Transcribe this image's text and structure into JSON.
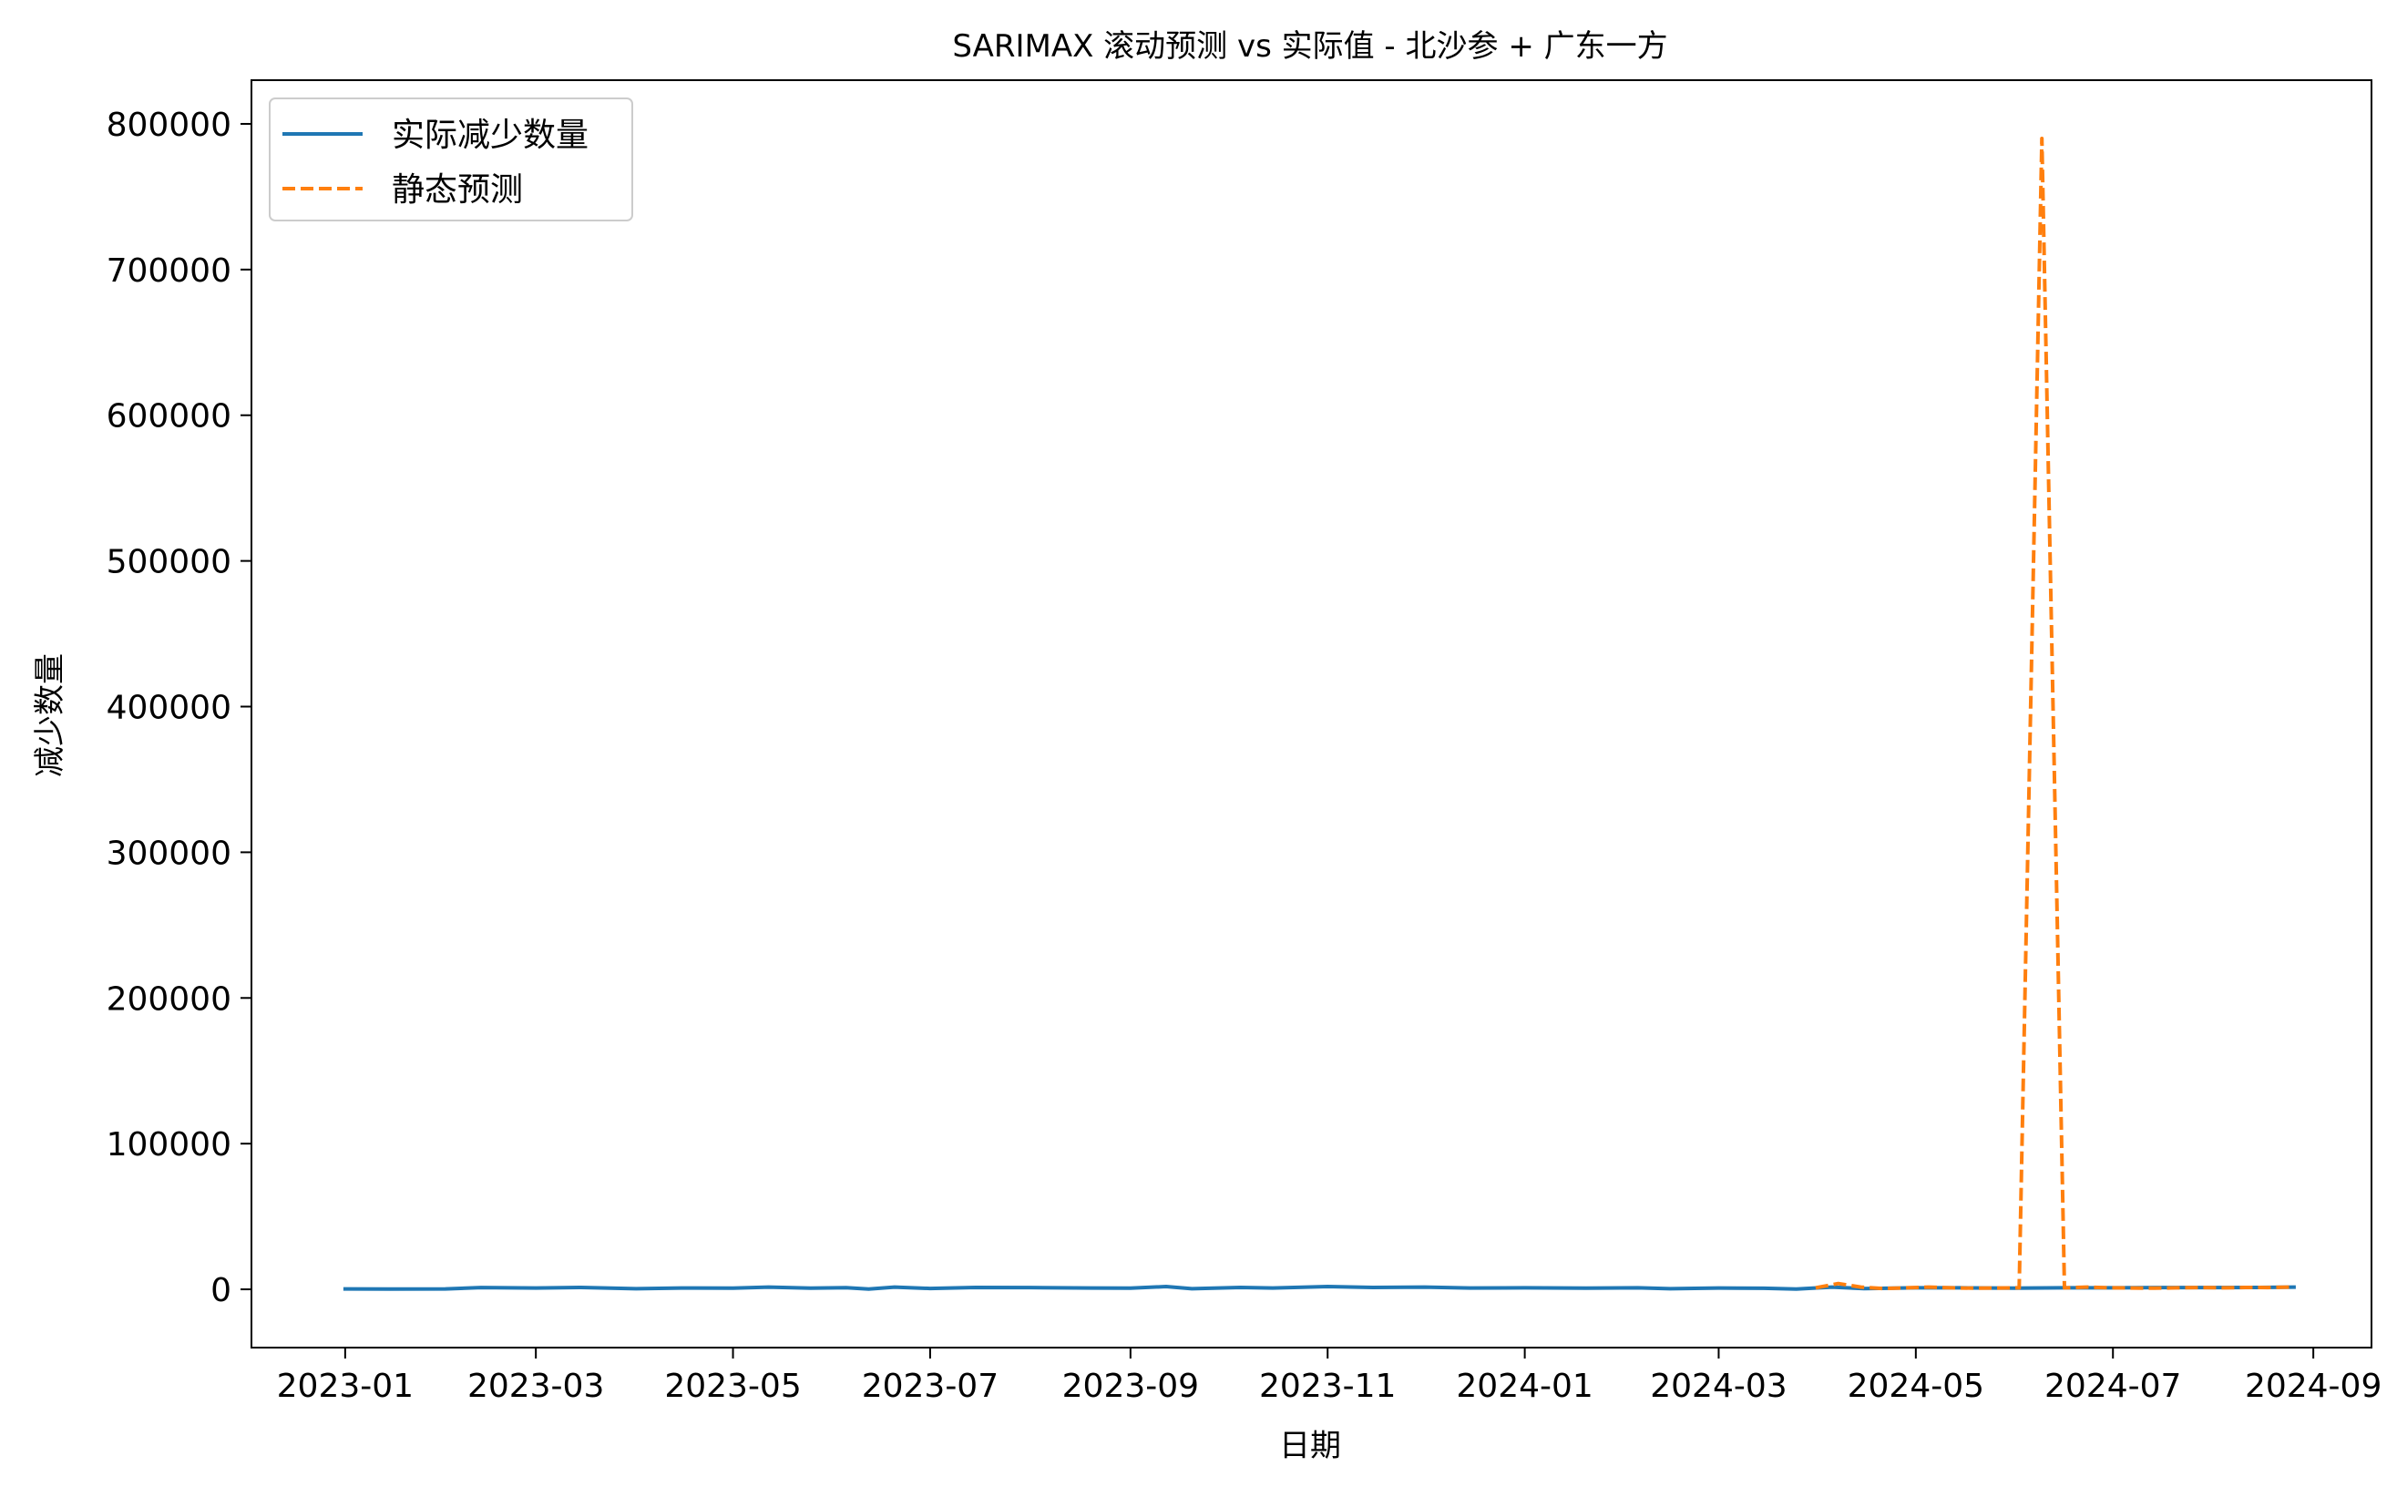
{
  "chart_data": {
    "type": "line",
    "title": "SARIMAX 滚动预测 vs 实际值 - 北沙参 + 广东一方",
    "xlabel": "日期",
    "ylabel": "减少数量",
    "x_ticks": [
      "2023-01",
      "2023-03",
      "2023-05",
      "2023-07",
      "2023-09",
      "2023-11",
      "2024-01",
      "2024-03",
      "2024-05",
      "2024-07",
      "2024-09"
    ],
    "y_ticks": [
      "0",
      "100000",
      "200000",
      "300000",
      "400000",
      "500000",
      "600000",
      "700000",
      "800000"
    ],
    "xlim": [
      "2022-12-03",
      "2024-09-19"
    ],
    "ylim": [
      -40000,
      830000
    ],
    "legend_position": "top-left",
    "grid": false,
    "series": [
      {
        "name": "实际减少数量",
        "color": "#1f77b4",
        "dash": "solid",
        "points": [
          [
            "2023-01-01",
            300
          ],
          [
            "2023-01-15",
            200
          ],
          [
            "2023-02-01",
            250
          ],
          [
            "2023-02-12",
            1200
          ],
          [
            "2023-03-01",
            900
          ],
          [
            "2023-03-15",
            1300
          ],
          [
            "2023-04-01",
            400
          ],
          [
            "2023-04-15",
            900
          ],
          [
            "2023-05-01",
            800
          ],
          [
            "2023-05-12",
            1500
          ],
          [
            "2023-05-25",
            800
          ],
          [
            "2023-06-05",
            1100
          ],
          [
            "2023-06-12",
            200
          ],
          [
            "2023-06-20",
            1500
          ],
          [
            "2023-07-01",
            600
          ],
          [
            "2023-07-15",
            1300
          ],
          [
            "2023-08-01",
            1200
          ],
          [
            "2023-08-20",
            900
          ],
          [
            "2023-09-01",
            800
          ],
          [
            "2023-09-12",
            1900
          ],
          [
            "2023-09-20",
            400
          ],
          [
            "2023-10-05",
            1300
          ],
          [
            "2023-10-15",
            900
          ],
          [
            "2023-11-01",
            1900
          ],
          [
            "2023-11-15",
            1300
          ],
          [
            "2023-12-01",
            1500
          ],
          [
            "2023-12-15",
            900
          ],
          [
            "2024-01-01",
            1000
          ],
          [
            "2024-01-20",
            800
          ],
          [
            "2024-02-05",
            1000
          ],
          [
            "2024-02-15",
            400
          ],
          [
            "2024-03-01",
            900
          ],
          [
            "2024-03-15",
            700
          ],
          [
            "2024-03-25",
            200
          ],
          [
            "2024-04-05",
            1500
          ],
          [
            "2024-04-15",
            500
          ],
          [
            "2024-05-01",
            1000
          ],
          [
            "2024-05-15",
            1000
          ],
          [
            "2024-06-01",
            800
          ],
          [
            "2024-06-15",
            1000
          ],
          [
            "2024-07-01",
            1000
          ],
          [
            "2024-07-15",
            1200
          ],
          [
            "2024-08-01",
            1200
          ],
          [
            "2024-08-15",
            1300
          ],
          [
            "2024-08-26",
            1500
          ]
        ]
      },
      {
        "name": "静态预测",
        "color": "#ff7f0e",
        "dash": "dashed",
        "points": [
          [
            "2024-03-31",
            1000
          ],
          [
            "2024-04-07",
            4000
          ],
          [
            "2024-04-14",
            1500
          ],
          [
            "2024-04-21",
            500
          ],
          [
            "2024-04-28",
            1000
          ],
          [
            "2024-05-05",
            1500
          ],
          [
            "2024-05-12",
            1000
          ],
          [
            "2024-05-19",
            800
          ],
          [
            "2024-05-26",
            900
          ],
          [
            "2024-06-02",
            1000
          ],
          [
            "2024-06-09",
            790000
          ],
          [
            "2024-06-16",
            1000
          ],
          [
            "2024-06-23",
            1500
          ],
          [
            "2024-06-30",
            1000
          ],
          [
            "2024-07-07",
            900
          ],
          [
            "2024-07-14",
            800
          ],
          [
            "2024-07-21",
            1000
          ],
          [
            "2024-07-28",
            1200
          ],
          [
            "2024-08-04",
            1000
          ],
          [
            "2024-08-11",
            1300
          ],
          [
            "2024-08-18",
            1200
          ],
          [
            "2024-08-25",
            1500
          ]
        ]
      }
    ]
  }
}
